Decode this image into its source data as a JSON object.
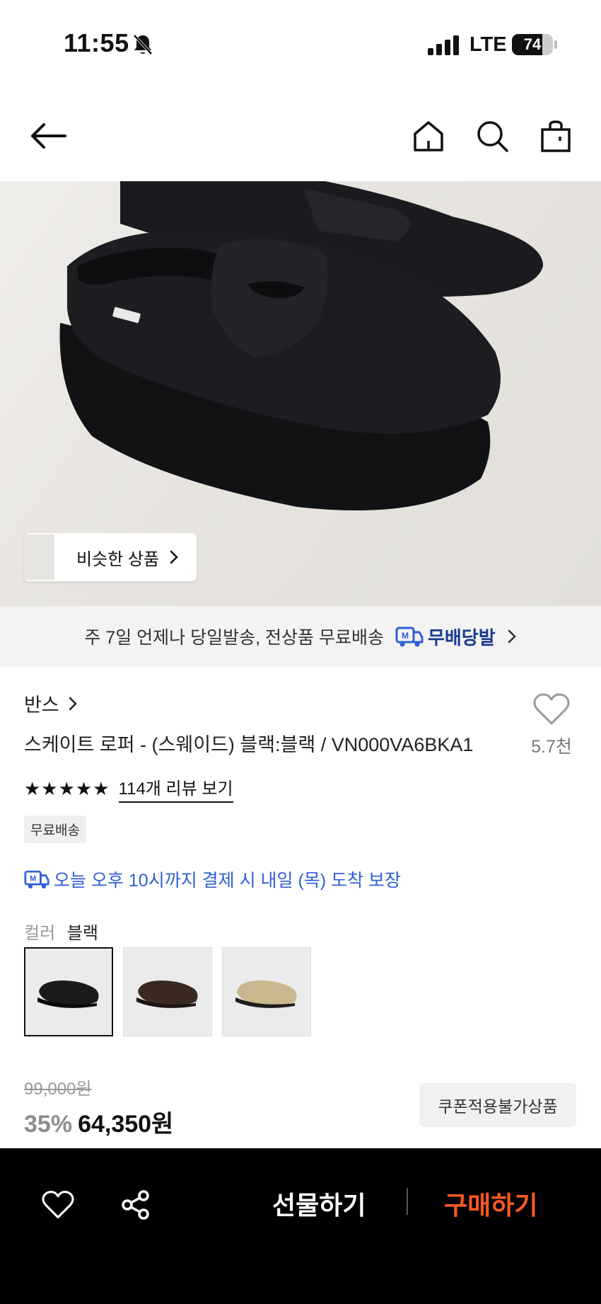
{
  "status": {
    "time": "11:55",
    "network": "LTE",
    "battery": "74",
    "battery_level": 0.74
  },
  "nav": {
    "back_icon": "arrow-left-icon",
    "home_icon": "home-icon",
    "search_icon": "search-icon",
    "cart_icon": "shopping-bag-icon"
  },
  "hero": {
    "similar_label": "비슷한 상품"
  },
  "banner": {
    "text": "주 7일 언제나 당일발송, 전상품 무료배송",
    "brand": "무배당발",
    "brand_color": "#1a3a8f"
  },
  "product": {
    "brand": "반스",
    "title": "스케이트 로퍼 - (스웨이드) 블랙:블랙 / VN000VA6BKA1",
    "like_count": "5.7천",
    "rating": 5,
    "stars": "★★★★★",
    "review_link": "114개 리뷰 보기",
    "tag": "무료배송",
    "delivery_text": "오늘 오후 10시까지 결제 시 내일 (목) 도착 보장",
    "delivery_color": "#2f5fd6"
  },
  "color": {
    "label": "컬러",
    "value": "블랙",
    "swatches": [
      {
        "name": "black",
        "color": "#1a1a1a",
        "selected": true
      },
      {
        "name": "brown",
        "color": "#3a2a22",
        "selected": false
      },
      {
        "name": "beige",
        "color": "#c9b88d",
        "selected": false
      }
    ]
  },
  "price": {
    "original": "99,000원",
    "discount": "35%",
    "sale": "64,350원",
    "coupon_tag": "쿠폰적용불가상품"
  },
  "bottom": {
    "gift_label": "선물하기",
    "buy_label": "구매하기",
    "buy_color": "#ff5a1f"
  }
}
